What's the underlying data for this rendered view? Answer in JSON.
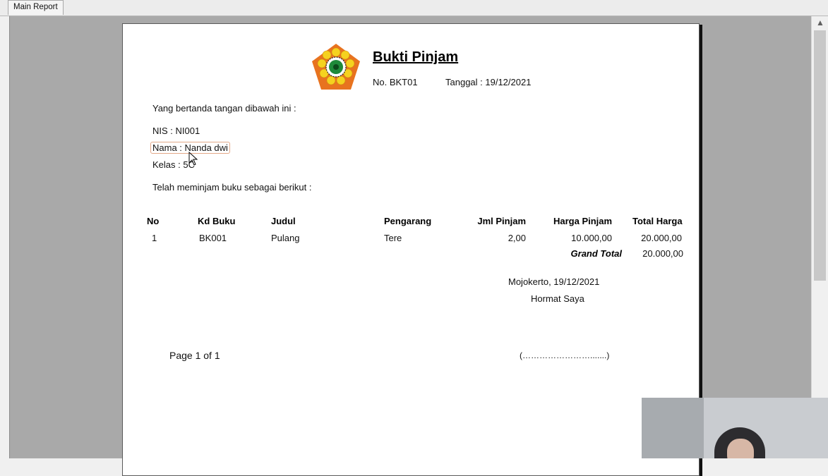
{
  "tabs": [
    {
      "label": "Main Report"
    }
  ],
  "scrollbar": {
    "up_arrow": "▲"
  },
  "report": {
    "title": "Bukti Pinjam",
    "doc_no": "No. BKT01",
    "date": "Tanggal : 19/12/2021",
    "intro": "Yang bertanda tangan dibawah ini :",
    "nis": "NIS : NI001",
    "nama": "Nama : Nanda dwi",
    "kelas": "Kelas : 5C",
    "borrow_text": "Telah meminjam buku sebagai berikut :",
    "table": {
      "headers": [
        "No",
        "Kd Buku",
        "Judul",
        "Pengarang",
        "Jml Pinjam",
        "Harga Pinjam",
        "Total Harga"
      ],
      "rows": [
        [
          "1",
          "BK001",
          "Pulang",
          "Tere",
          "2,00",
          "10.000,00",
          "20.000,00"
        ]
      ],
      "grand_total_label": "Grand Total",
      "grand_total_value": "20.000,00"
    },
    "place_date": "Mojokerto, 19/12/2021",
    "greeting": "Hormat Saya",
    "signature_line": "(…………………….......)",
    "page_info": "Page 1 of 1"
  },
  "colors": {
    "logo_orange": "#e8731f",
    "logo_yellow": "#f5d21f",
    "logo_green": "#1f8a3a"
  }
}
